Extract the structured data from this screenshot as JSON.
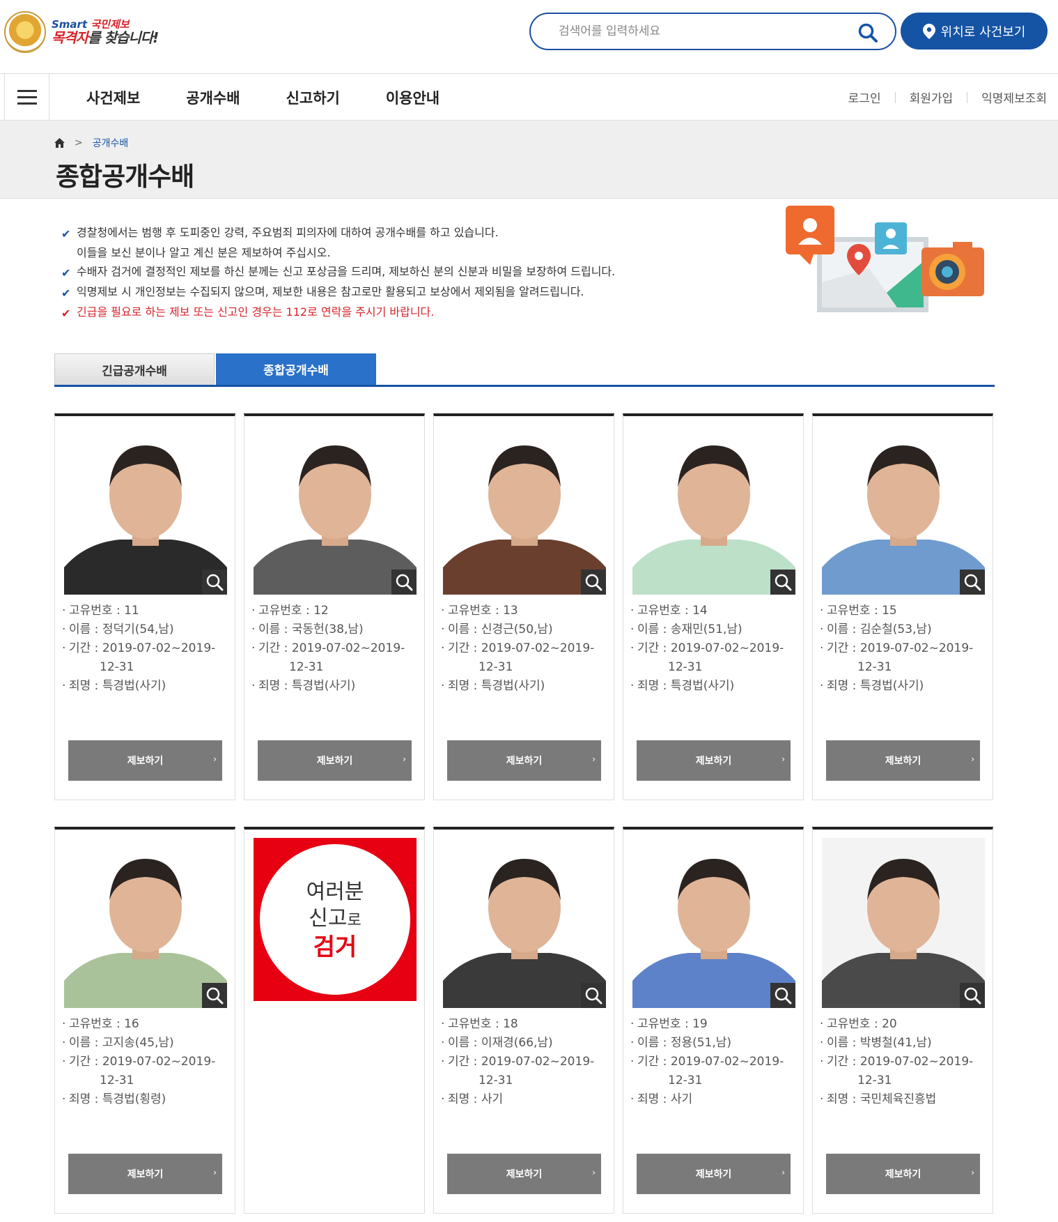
{
  "header": {
    "logo_line1_a": "Smart",
    "logo_line1_b": " 국민제보",
    "logo_line2_a": "목격자",
    "logo_line2_b": "를 찾습니다!",
    "search_placeholder": "검색어를 입력하세요",
    "location_button": "위치로 사건보기"
  },
  "nav": {
    "items": [
      "사건제보",
      "공개수배",
      "신고하기",
      "이용안내"
    ],
    "util": [
      "로그인",
      "회원가입",
      "익명제보조회"
    ]
  },
  "breadcrumb": {
    "current": "공개수배"
  },
  "page_title": "종합공개수배",
  "notices": [
    "경찰청에서는 범행 후 도피중인 강력, 주요범죄 피의자에 대하여 공개수배를 하고 있습니다.",
    "이들을 보신 분이나 알고 계신 분은 제보하여 주십시오.",
    "수배자 검거에 결정적인 제보를 하신 분께는 신고 포상금을 드리며, 제보하신 분의 신분과 비밀을 보장하여 드립니다.",
    "익명제보 시 개인정보는 수집되지 않으며, 제보한 내용은 참고로만 활용되고 보상에서 제외됨을 알려드립니다.",
    "긴급을 필요로 하는 제보 또는 신고인 경우는 112로 연락을 주시기 바랍니다."
  ],
  "tabs": [
    "긴급공개수배",
    "종합공개수배"
  ],
  "labels": {
    "id": "고유번호 : ",
    "name": "이름 : ",
    "period": "기간 : ",
    "crime": "죄명 : ",
    "tip_button": "제보하기",
    "chevron": "›"
  },
  "promo": {
    "line1": "여러분",
    "line2a": "신고",
    "line2b": "로",
    "line3": "검거"
  },
  "cards": [
    {
      "id": "11",
      "name": "정덕기(54,남)",
      "period1": "2019-07-02~2019-",
      "period2": "12-31",
      "crime": "특경법(사기)"
    },
    {
      "id": "12",
      "name": "국동헌(38,남)",
      "period1": "2019-07-02~2019-",
      "period2": "12-31",
      "crime": "특경법(사기)"
    },
    {
      "id": "13",
      "name": "신경근(50,남)",
      "period1": "2019-07-02~2019-",
      "period2": "12-31",
      "crime": "특경법(사기)"
    },
    {
      "id": "14",
      "name": "송재민(51,남)",
      "period1": "2019-07-02~2019-",
      "period2": "12-31",
      "crime": "특경법(사기)"
    },
    {
      "id": "15",
      "name": "김순철(53,남)",
      "period1": "2019-07-02~2019-",
      "period2": "12-31",
      "crime": "특경법(사기)"
    },
    {
      "id": "16",
      "name": "고지송(45,남)",
      "period1": "2019-07-02~2019-",
      "period2": "12-31",
      "crime": "특경법(횡령)"
    },
    {
      "promo": true
    },
    {
      "id": "18",
      "name": "이재경(66,남)",
      "period1": "2019-07-02~2019-",
      "period2": "12-31",
      "crime": "사기"
    },
    {
      "id": "19",
      "name": "정용(51,남)",
      "period1": "2019-07-02~2019-",
      "period2": "12-31",
      "crime": "사기"
    },
    {
      "id": "20",
      "name": "박병철(41,남)",
      "period1": "2019-07-02~2019-",
      "period2": "12-31",
      "crime": "국민체육진흥법"
    }
  ],
  "colors": {
    "primary": "#1553a5",
    "alert": "#d8232a",
    "button_gray": "#7a7a7a"
  }
}
